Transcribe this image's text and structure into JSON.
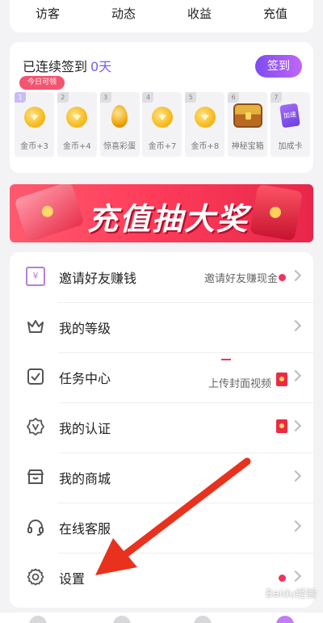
{
  "stats": {
    "items": [
      "访客",
      "动态",
      "收益",
      "充值"
    ]
  },
  "signin": {
    "title": "已连续签到",
    "days": "0天",
    "button": "签到",
    "today_tag": "今日可领",
    "days_list": [
      {
        "num": "1",
        "label": "金币+3",
        "icon": "coin-icon"
      },
      {
        "num": "2",
        "label": "金币+4",
        "icon": "coin-icon"
      },
      {
        "num": "3",
        "label": "惊喜彩蛋",
        "icon": "golden-egg-icon"
      },
      {
        "num": "4",
        "label": "金币+7",
        "icon": "coin-icon"
      },
      {
        "num": "5",
        "label": "金币+8",
        "icon": "coin-icon"
      },
      {
        "num": "6",
        "label": "神秘宝箱",
        "icon": "treasure-chest-icon"
      },
      {
        "num": "7",
        "label": "加成卡",
        "icon": "bonus-card-icon"
      }
    ],
    "bonus_card_text": "加速"
  },
  "banner": {
    "text": "充值抽大奖"
  },
  "menu": {
    "items": [
      {
        "label": "邀请好友赚钱",
        "right_text": "邀请好友赚现金",
        "icon": "invite-icon"
      },
      {
        "label": "我的等级",
        "right_text": "",
        "icon": "crown-icon"
      },
      {
        "label": "任务中心",
        "right_text": "上传封面视频",
        "icon": "task-check-icon"
      },
      {
        "label": "我的认证",
        "right_text": "",
        "icon": "verify-badge-icon"
      },
      {
        "label": "我的商城",
        "right_text": "",
        "icon": "store-icon"
      },
      {
        "label": "在线客服",
        "right_text": "",
        "icon": "headset-icon"
      },
      {
        "label": "设置",
        "right_text": "",
        "icon": "gear-icon"
      }
    ],
    "invite_icon_glyph": "¥"
  },
  "watermark": "Baidu经验",
  "colors": {
    "accent_purple": "#7a5cf5",
    "alert_red": "#f0355a",
    "banner_red": "#ff3d5a",
    "arrow_red": "#e8321e"
  }
}
